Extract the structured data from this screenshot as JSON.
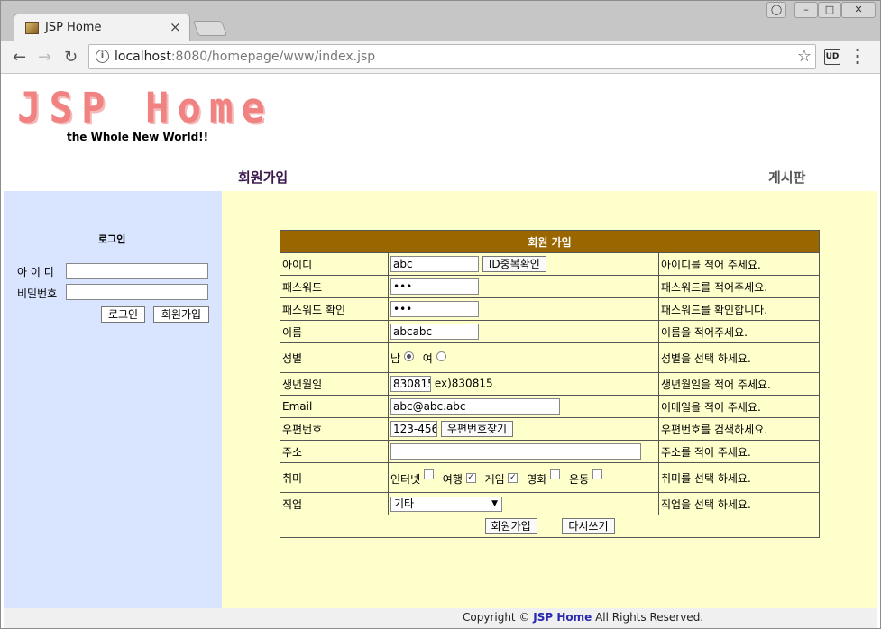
{
  "browser": {
    "tab_title": "JSP Home",
    "tab_close": "×",
    "url_host": "localhost",
    "url_rest": ":8080/homepage/www/index.jsp",
    "ext_label": "UD"
  },
  "header": {
    "logo": "JSP Home",
    "slogan": "the Whole New World!!",
    "nav_join": "회원가입",
    "nav_board": "게시판"
  },
  "login": {
    "title": "로그인",
    "id_label": "아 이 디",
    "pw_label": "비밀번호",
    "login_button": "로그인",
    "join_button": "회원가입"
  },
  "form": {
    "title": "회원 가입",
    "rows": {
      "id": {
        "label": "아이디",
        "value": "abc",
        "button": "ID중복확인",
        "help": "아이디를 적어 주세요."
      },
      "pw": {
        "label": "패스워드",
        "value": "•••",
        "help": "패스워드를 적어주세요."
      },
      "pw2": {
        "label": "패스워드 확인",
        "value": "•••",
        "help": "패스워드를 확인합니다."
      },
      "name": {
        "label": "이름",
        "value": "abcabc",
        "help": "이름을 적어주세요."
      },
      "gender": {
        "label": "성별",
        "male": "남",
        "female": "여",
        "selected": "남",
        "help": "성별을 선택 하세요."
      },
      "birth": {
        "label": "생년월일",
        "value": "830815",
        "example": "ex)830815",
        "help": "생년월일을 적어 주세요."
      },
      "email": {
        "label": "Email",
        "value": "abc@abc.abc",
        "help": "이메일을 적어 주세요."
      },
      "zip": {
        "label": "우편번호",
        "value": "123-456",
        "button": "우편번호찾기",
        "help": "우편번호를 검색하세요."
      },
      "addr": {
        "label": "주소",
        "value": "",
        "help": "주소를 적어 주세요."
      },
      "hobby": {
        "label": "취미",
        "options": [
          {
            "name": "인터넷",
            "checked": false
          },
          {
            "name": "여행",
            "checked": true
          },
          {
            "name": "게임",
            "checked": true
          },
          {
            "name": "영화",
            "checked": false
          },
          {
            "name": "운동",
            "checked": false
          }
        ],
        "help": "취미를 선택 하세요."
      },
      "job": {
        "label": "직업",
        "selected": "기타",
        "help": "직업을 선택 하세요."
      }
    },
    "submit": "회원가입",
    "reset": "다시쓰기"
  },
  "footer": {
    "prefix": "Copyright © ",
    "brand": "JSP Home",
    "suffix": " All Rights Reserved."
  }
}
